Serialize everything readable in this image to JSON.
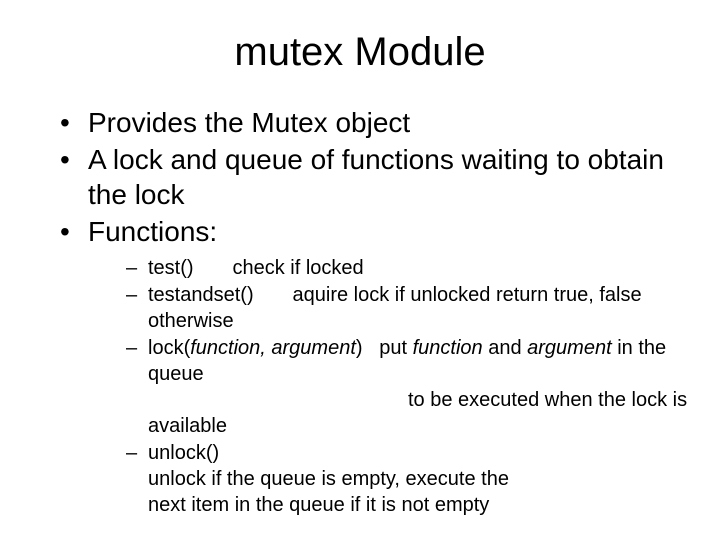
{
  "title": "mutex Module",
  "bullets": {
    "b1": "Provides the Mutex object",
    "b2": "A lock and queue of functions waiting to obtain the lock",
    "b3": "Functions:"
  },
  "sub": {
    "s1_fn": "test()",
    "s1_desc": "check if locked",
    "s2_fn": "testandset()",
    "s2_desc": "aquire lock if unlocked return true, false otherwise",
    "s3_fn_a": "lock(",
    "s3_fn_args": "function, argument",
    "s3_fn_b": ")",
    "s3_desc_a": "put ",
    "s3_desc_fn": "function",
    "s3_desc_b": " and ",
    "s3_desc_arg": "argument",
    "s3_desc_c": " in the queue",
    "s3_line2": "to be executed when the lock is",
    "s3_line3": "available",
    "s4_fn": "unlock()",
    "s4_desc": "unlock if the queue is empty, execute the next item in the queue if it is not empty"
  }
}
